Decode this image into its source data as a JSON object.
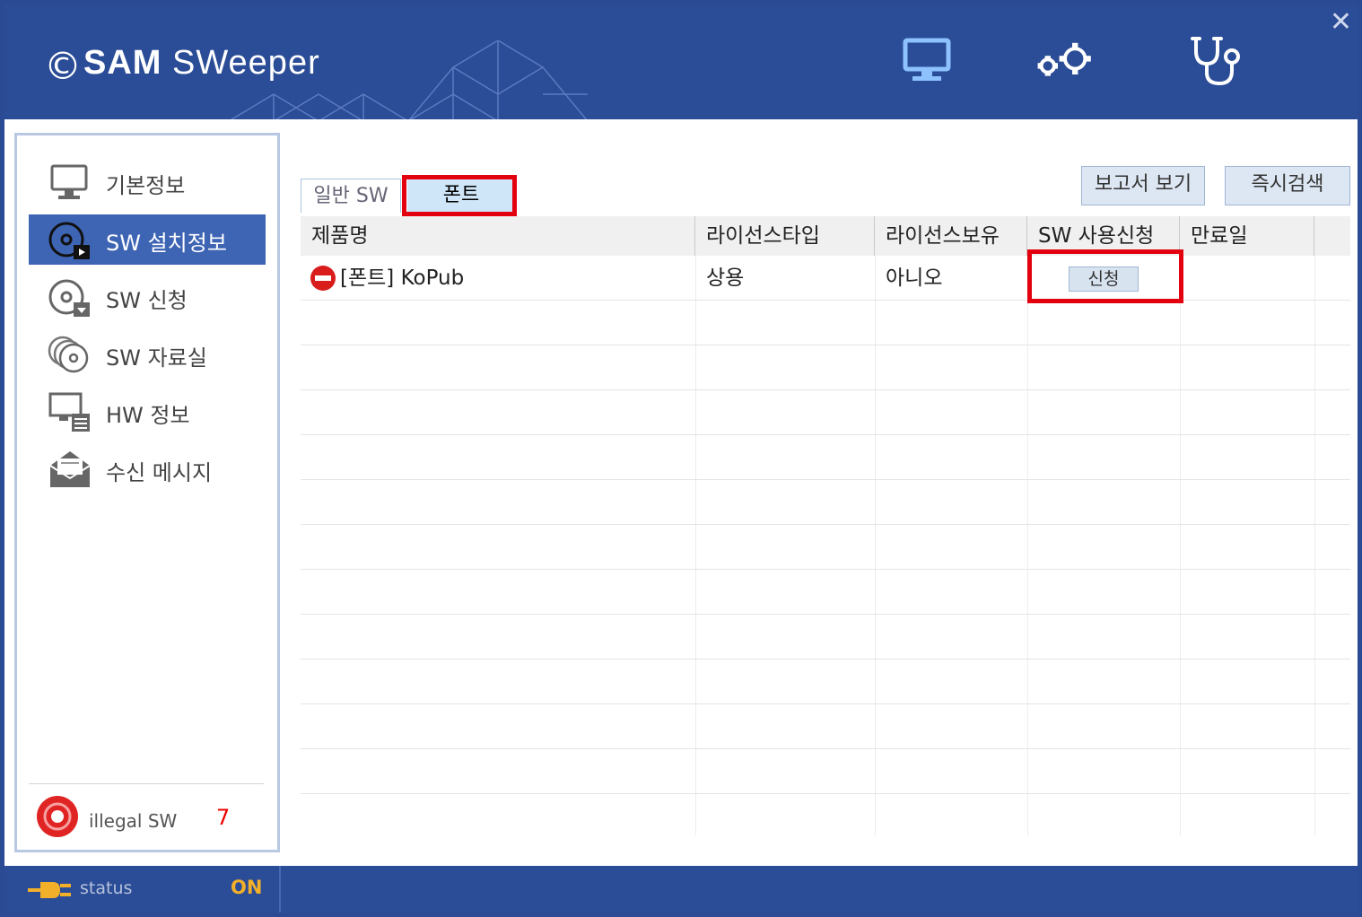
{
  "app": {
    "logo_symbol": "©",
    "logo_bold": "SAM",
    "logo_rest": "SWeeper",
    "close_glyph": "✕"
  },
  "header_icons": [
    "monitor-icon",
    "settings-gears-icon",
    "stethoscope-icon"
  ],
  "sidebar": {
    "items": [
      {
        "label": "기본정보",
        "icon": "monitor-icon"
      },
      {
        "label": "SW 설치정보",
        "icon": "disc-install-icon",
        "active": true
      },
      {
        "label": "SW 신청",
        "icon": "disc-download-icon"
      },
      {
        "label": "SW 자료실",
        "icon": "discs-stack-icon"
      },
      {
        "label": "HW 정보",
        "icon": "hardware-icon"
      },
      {
        "label": "수신 메시지",
        "icon": "envelope-icon"
      }
    ],
    "illegal": {
      "label": "illegal  SW",
      "count": "7"
    }
  },
  "tabs": [
    {
      "label": "일반 SW"
    },
    {
      "label": "폰트",
      "active": true
    }
  ],
  "buttons": {
    "report": "보고서 보기",
    "scan": "즉시검색"
  },
  "table": {
    "columns": [
      "제품명",
      "라이선스타입",
      "라이선스보유",
      "SW 사용신청",
      "만료일"
    ],
    "rows": [
      {
        "name": "[폰트] KoPub",
        "license_type": "상용",
        "license_owned": "아니오",
        "apply_button": "신청",
        "expiry": ""
      }
    ]
  },
  "statusbar": {
    "label": "status",
    "value": "ON"
  },
  "colors": {
    "brand_blue": "#2b4c96",
    "active_nav": "#3e64b4",
    "highlight_red": "#e3000f",
    "status_on": "#f2b02a"
  }
}
